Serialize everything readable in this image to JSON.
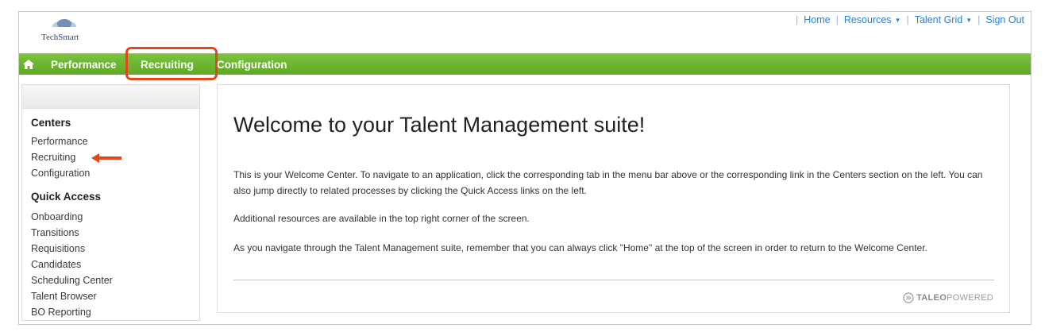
{
  "header": {
    "logo_text": "TechSmart",
    "links": [
      {
        "label": "Home",
        "dropdown": false
      },
      {
        "label": "Resources",
        "dropdown": true
      },
      {
        "label": "Talent Grid",
        "dropdown": true
      },
      {
        "label": "Sign Out",
        "dropdown": false
      }
    ]
  },
  "navbar": {
    "home_icon": "home-icon",
    "items": [
      "Performance",
      "Recruiting",
      "Configuration"
    ],
    "highlighted": "Recruiting",
    "color": "#6bb62f"
  },
  "sidebar": {
    "centers_heading": "Centers",
    "centers": [
      "Performance",
      "Recruiting",
      "Configuration"
    ],
    "quick_access_heading": "Quick Access",
    "quick_access": [
      "Onboarding",
      "Transitions",
      "Requisitions",
      "Candidates",
      "Scheduling Center",
      "Talent Browser",
      "BO Reporting"
    ]
  },
  "main": {
    "title": "Welcome to your Talent Management suite!",
    "paragraphs": [
      "This is your Welcome Center. To navigate to an application, click the corresponding tab in the menu bar above or the corresponding link in the Centers section on the left. You can also jump directly to related processes by clicking the Quick Access links on the left.",
      "Additional resources are available in the top right corner of the screen.",
      "As you navigate through the Talent Management suite, remember that you can always click \"Home\" at the top of the screen in order to return to the Welcome Center."
    ],
    "powered_brand": "TALEO",
    "powered_suffix": "POWERED"
  },
  "annotation_color": "#e2471b"
}
